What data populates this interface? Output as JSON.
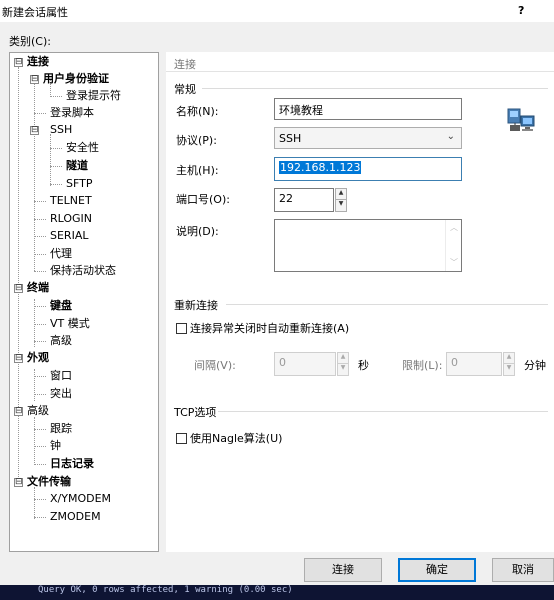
{
  "window": {
    "title": "新建会话属性",
    "help": "?"
  },
  "category_label": "类别(C):",
  "tree": {
    "items": [
      {
        "label": "连接",
        "bold": true
      },
      {
        "label": "用户身份验证",
        "bold": true
      },
      {
        "label": "登录提示符",
        "bold": false
      },
      {
        "label": "登录脚本",
        "bold": false
      },
      {
        "label": "SSH",
        "bold": false
      },
      {
        "label": "安全性",
        "bold": false
      },
      {
        "label": "隧道",
        "bold": true
      },
      {
        "label": "SFTP",
        "bold": false
      },
      {
        "label": "TELNET",
        "bold": false
      },
      {
        "label": "RLOGIN",
        "bold": false
      },
      {
        "label": "SERIAL",
        "bold": false
      },
      {
        "label": "代理",
        "bold": false
      },
      {
        "label": "保持活动状态",
        "bold": false
      },
      {
        "label": "终端",
        "bold": true
      },
      {
        "label": "键盘",
        "bold": true
      },
      {
        "label": "VT 模式",
        "bold": false
      },
      {
        "label": "高级",
        "bold": false
      },
      {
        "label": "外观",
        "bold": true
      },
      {
        "label": "窗口",
        "bold": false
      },
      {
        "label": "突出",
        "bold": false
      },
      {
        "label": "高级",
        "bold": false
      },
      {
        "label": "跟踪",
        "bold": false
      },
      {
        "label": "钟",
        "bold": false
      },
      {
        "label": "日志记录",
        "bold": true
      },
      {
        "label": "文件传输",
        "bold": true
      },
      {
        "label": "X/YMODEM",
        "bold": false
      },
      {
        "label": "ZMODEM",
        "bold": false
      }
    ],
    "expander_minus": "⊟"
  },
  "panel": {
    "header": "连接",
    "general": {
      "title": "常规",
      "name_label": "名称(N):",
      "name_value": "环境教程",
      "protocol_label": "协议(P):",
      "protocol_value": "SSH",
      "host_label": "主机(H):",
      "host_value": "192.168.1.123",
      "port_label": "端口号(O):",
      "port_value": "22",
      "desc_label": "说明(D):",
      "desc_value": ""
    },
    "reconnect": {
      "title": "重新连接",
      "auto_label": "连接异常关闭时自动重新连接(A)",
      "auto_checked": false,
      "interval_label": "间隔(V):",
      "interval_value": "0",
      "interval_unit": "秒",
      "limit_label": "限制(L):",
      "limit_value": "0",
      "limit_unit": "分钟"
    },
    "tcp": {
      "title": "TCP选项",
      "nagle_label": "使用Nagle算法(U)",
      "nagle_checked": false
    }
  },
  "buttons": {
    "connect": "连接",
    "ok": "确定",
    "cancel": "取消"
  },
  "background_terminal_text": "Query OK, 0 rows affected, 1 warning (0.00 sec)",
  "icons": {
    "network": "network-computer-icon"
  },
  "colors": {
    "selection": "#0078d7",
    "accent_border": "#0078d7"
  }
}
